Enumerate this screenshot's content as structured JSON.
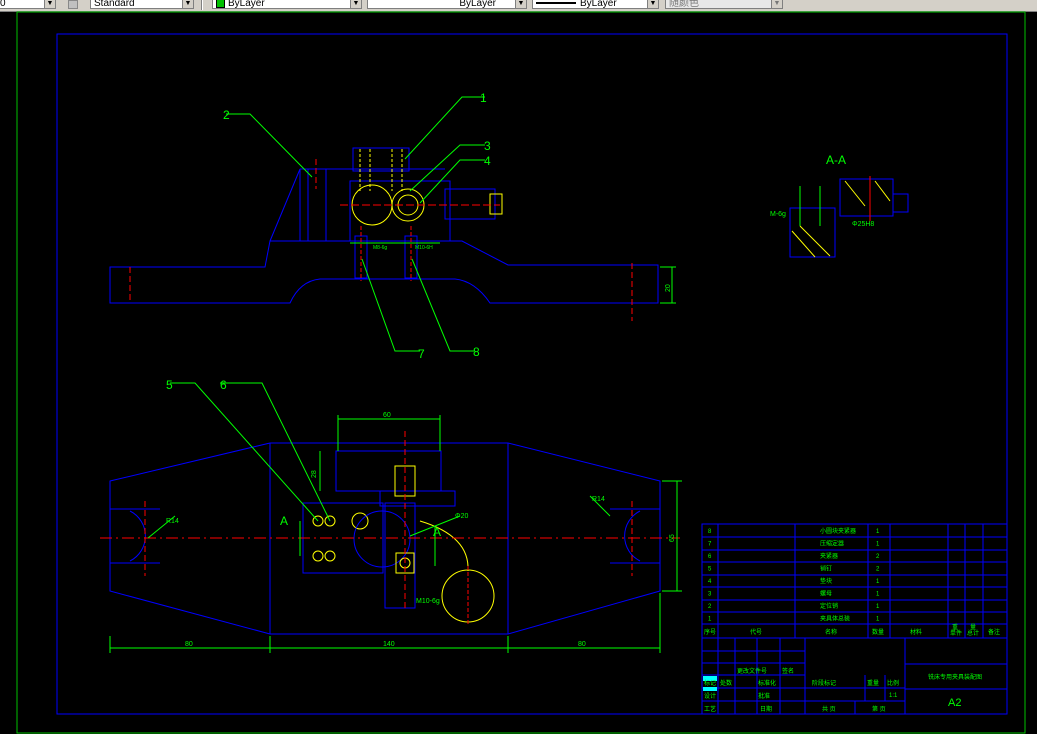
{
  "toolbar": {
    "combo0": "0",
    "textstyle": "Standard",
    "layer": "ByLayer",
    "linetype": "ByLayer",
    "lineweight": "ByLayer",
    "plotstyle": "随颜色"
  },
  "drawing": {
    "top_view_balloons": [
      "1",
      "2",
      "3",
      "4",
      "7",
      "8"
    ],
    "front_view_balloons": [
      "5",
      "6"
    ],
    "section_title": "A-A",
    "section_marker": "A",
    "dims": {
      "top_width": "60",
      "top_height": "28",
      "height_right": "65",
      "left_len": "80",
      "mid_len": "140",
      "right_len": "80",
      "r_left": "R14",
      "r_right": "R14",
      "hole_dia": "Φ20",
      "thread": "M10-6g",
      "side_height": "20",
      "sec_fit": "Φ25H8",
      "sec_thread": "M-6g",
      "top_hole1": "M8-6g",
      "top_hole2": "M10-6H"
    },
    "parts": [
      {
        "no": "8",
        "name": "小圆块夹紧器",
        "qty": "1"
      },
      {
        "no": "7",
        "name": "压缩定器",
        "qty": "1"
      },
      {
        "no": "6",
        "name": "夹紧器",
        "qty": "2"
      },
      {
        "no": "5",
        "name": "销钉",
        "qty": "2"
      },
      {
        "no": "4",
        "name": "垫块",
        "qty": "1"
      },
      {
        "no": "3",
        "name": "螺母",
        "qty": "1"
      },
      {
        "no": "2",
        "name": "定位销",
        "qty": "1"
      },
      {
        "no": "1",
        "name": "夹具体总装",
        "qty": "1"
      }
    ],
    "parts_header": [
      "序号",
      "代号",
      "名称",
      "数量",
      "材料",
      "单件",
      "总计",
      "备注"
    ],
    "parts_header_sub": [
      "重",
      "量"
    ],
    "title_block": {
      "drawing_name": "铣床专用夹具装配图",
      "sheet_size": "A2",
      "stage_label": "阶段标记",
      "weight_label": "重量",
      "scale_label": "比例",
      "scale_value": "1:1",
      "sheet_label": "共 页",
      "page_label": "第 页",
      "row_labels": [
        "标记",
        "设计",
        "审核",
        "工艺"
      ],
      "col_labels": [
        "处数",
        "标准化",
        "批准"
      ],
      "sign_labels": [
        "更改文件号",
        "签名",
        "日期"
      ]
    }
  }
}
